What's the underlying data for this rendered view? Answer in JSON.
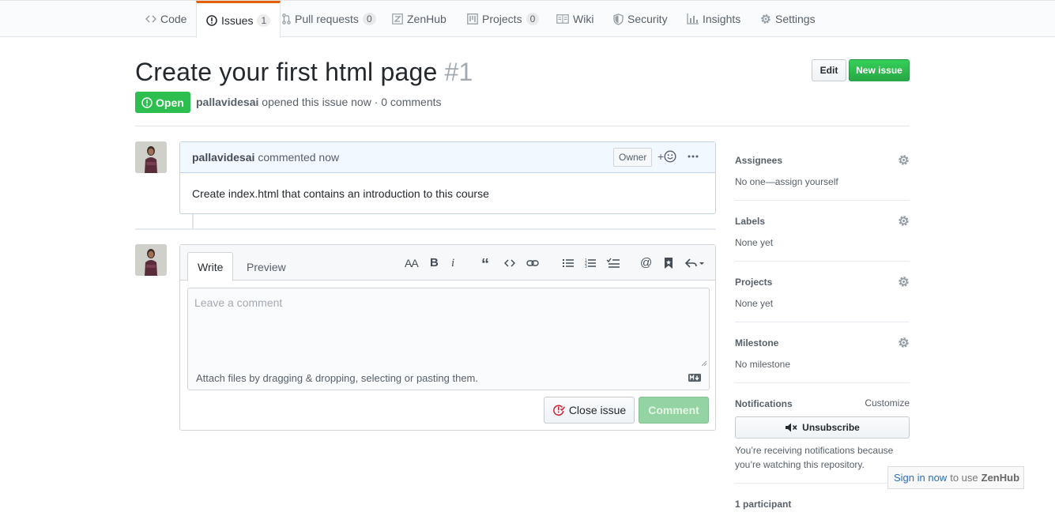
{
  "nav": {
    "tabs": [
      {
        "label": "Code",
        "icon": "code-icon"
      },
      {
        "label": "Issues",
        "count": "1",
        "icon": "issue-opened-icon"
      },
      {
        "label": "Pull requests",
        "count": "0",
        "icon": "pull-request-icon"
      },
      {
        "label": "ZenHub",
        "icon": "zenhub-icon"
      },
      {
        "label": "Projects",
        "count": "0",
        "icon": "project-icon"
      },
      {
        "label": "Wiki",
        "icon": "book-icon"
      },
      {
        "label": "Security",
        "icon": "shield-icon"
      },
      {
        "label": "Insights",
        "icon": "graph-icon"
      },
      {
        "label": "Settings",
        "icon": "gear-icon"
      }
    ]
  },
  "issue": {
    "title": "Create your first html page",
    "number": "#1",
    "edit_label": "Edit",
    "new_issue_label": "New issue",
    "state": "Open",
    "author": "pallavidesai",
    "meta_text": "opened this issue now · 0 comments"
  },
  "comment": {
    "author": "pallavidesai",
    "time": "commented now",
    "owner_label": "Owner",
    "body": "Create index.html that contains an introduction to this course"
  },
  "form": {
    "write_tab": "Write",
    "preview_tab": "Preview",
    "placeholder": "Leave a comment",
    "attach_text": "Attach files by dragging & dropping, selecting or pasting them.",
    "close_label": "Close issue",
    "comment_label": "Comment"
  },
  "sidebar": {
    "assignees": {
      "heading": "Assignees",
      "value": "No one—assign yourself"
    },
    "labels": {
      "heading": "Labels",
      "value": "None yet"
    },
    "projects": {
      "heading": "Projects",
      "value": "None yet"
    },
    "milestone": {
      "heading": "Milestone",
      "value": "No milestone"
    },
    "notifications": {
      "heading": "Notifications",
      "customize": "Customize",
      "unsubscribe": "Unsubscribe",
      "note": "You’re receiving notifications because you’re watching this repository."
    },
    "participants": "1 participant"
  },
  "zenhub": {
    "link": "Sign in now",
    "text": "to use",
    "brand": "ZenHub"
  },
  "colors": {
    "accent": "#e36209",
    "open": "#2cbe4e",
    "link": "#0366d6"
  }
}
